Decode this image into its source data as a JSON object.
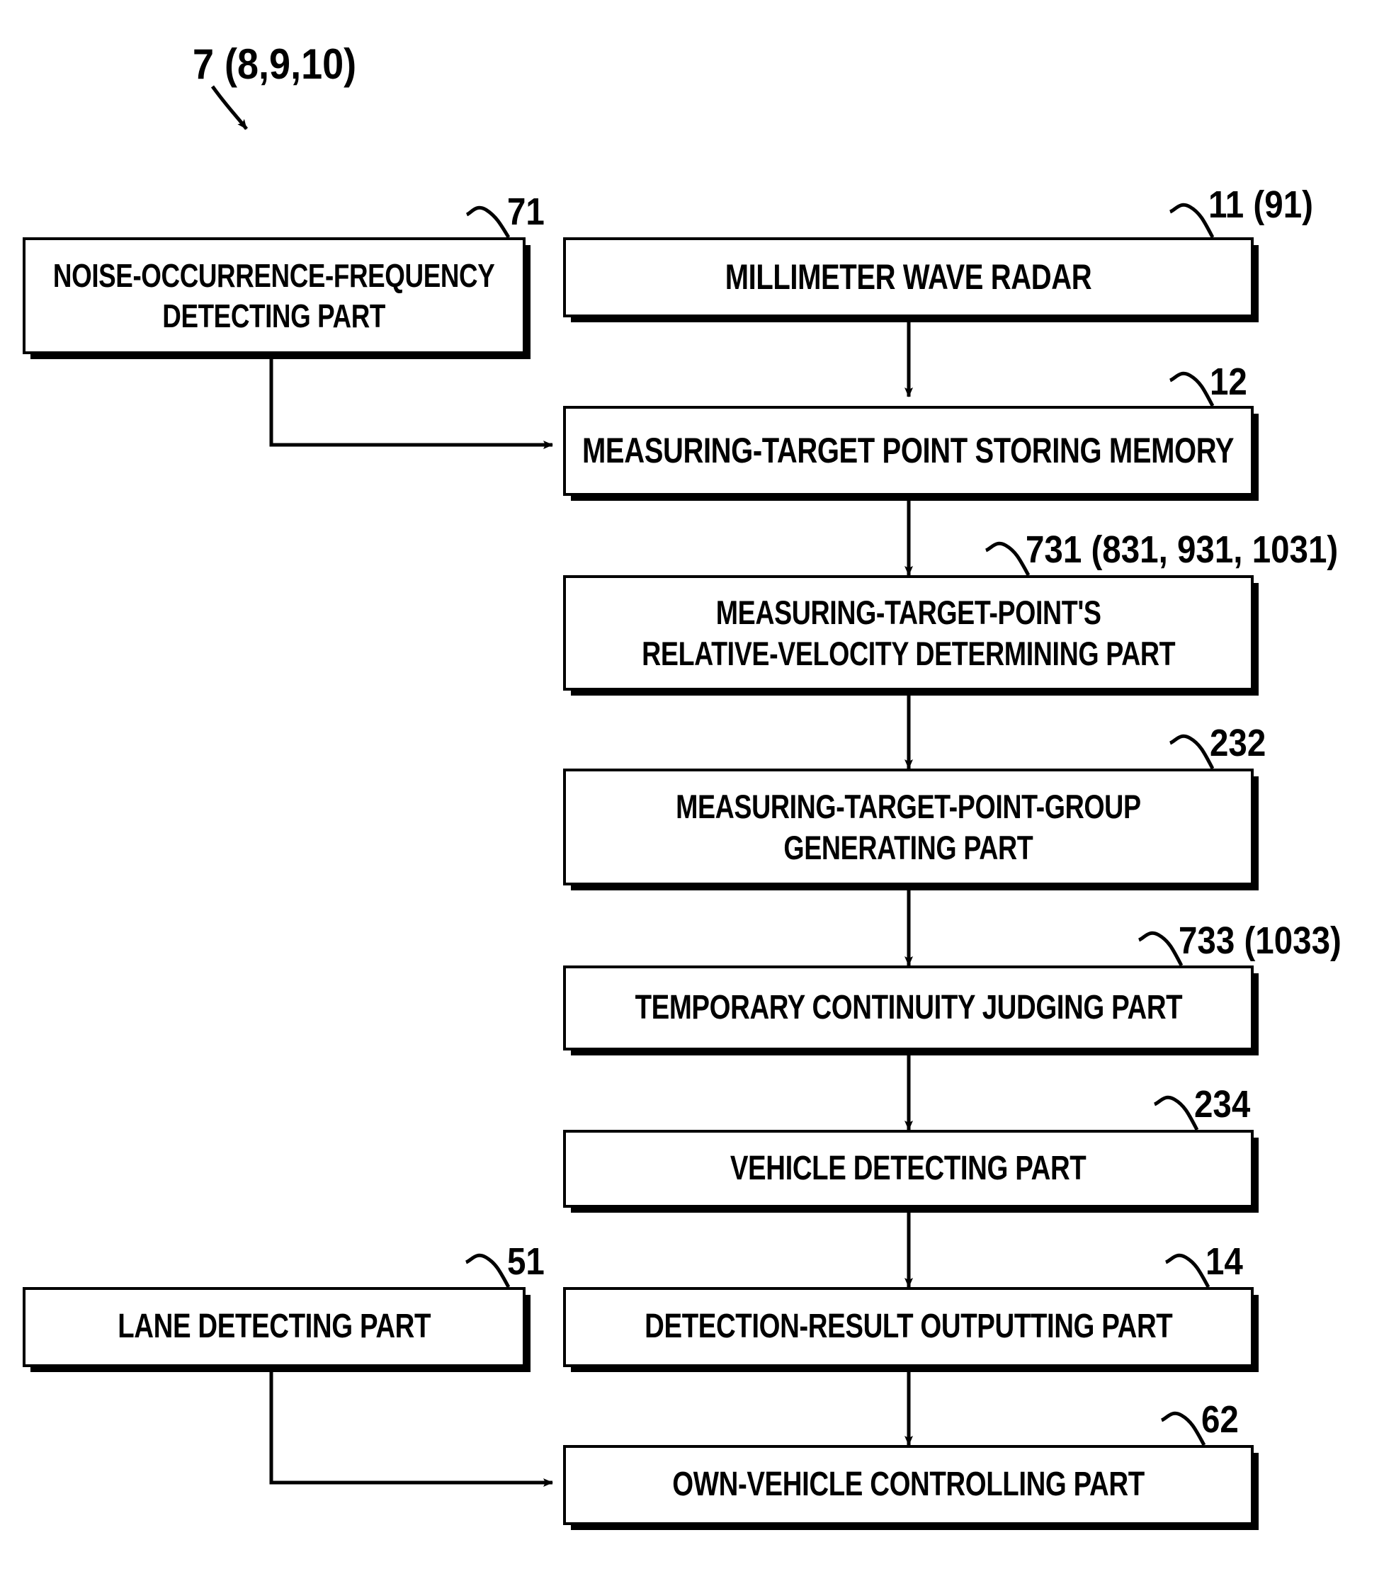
{
  "figure": {
    "main_ref": "7 (8,9,10)"
  },
  "nodes": [
    {
      "id": "noise-occurrence-frequency-detecting-part",
      "label": "NOISE-OCCURRENCE-FREQUENCY\nDETECTING PART",
      "ref": "71"
    },
    {
      "id": "millimeter-wave-radar",
      "label": "MILLIMETER WAVE RADAR",
      "ref": "11 (91)"
    },
    {
      "id": "measuring-target-point-storing-memory",
      "label": "MEASURING-TARGET POINT STORING MEMORY",
      "ref": "12"
    },
    {
      "id": "measuring-target-points-relative-velocity-determining-part",
      "label": "MEASURING-TARGET-POINT'S\nRELATIVE-VELOCITY DETERMINING PART",
      "ref": "731 (831, 931, 1031)"
    },
    {
      "id": "measuring-target-point-group-generating-part",
      "label": "MEASURING-TARGET-POINT-GROUP\nGENERATING PART",
      "ref": "232"
    },
    {
      "id": "temporary-continuity-judging-part",
      "label": "TEMPORARY CONTINUITY JUDGING PART",
      "ref": "733 (1033)"
    },
    {
      "id": "vehicle-detecting-part",
      "label": "VEHICLE DETECTING PART",
      "ref": "234"
    },
    {
      "id": "lane-detecting-part",
      "label": "LANE DETECTING PART",
      "ref": "51"
    },
    {
      "id": "detection-result-outputting-part",
      "label": "DETECTION-RESULT OUTPUTTING PART",
      "ref": "14"
    },
    {
      "id": "own-vehicle-controlling-part",
      "label": "OWN-VEHICLE CONTROLLING PART",
      "ref": "62"
    }
  ],
  "colors": {
    "line": "#000000",
    "background": "#ffffff"
  }
}
